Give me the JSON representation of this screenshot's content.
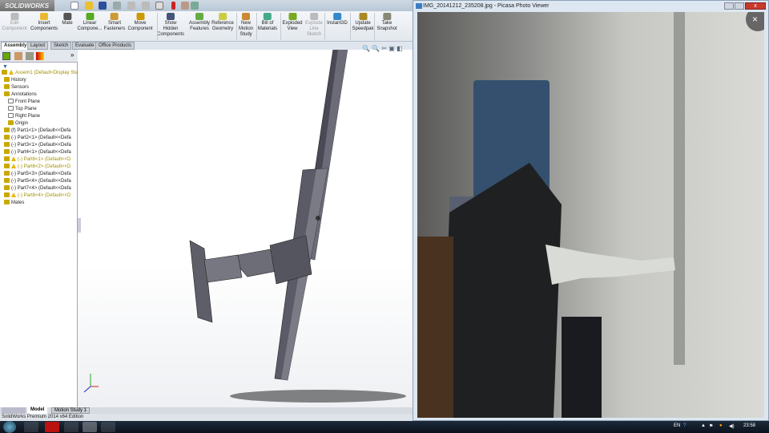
{
  "solidworks": {
    "logo": "SOLIDWORKS",
    "ribbon": [
      {
        "label": "Edit\nComponent",
        "disabled": true
      },
      {
        "label": "Insert\nComponents"
      },
      {
        "label": "Mate"
      },
      {
        "label": "Linear\nCompone..."
      },
      {
        "label": "Smart\nFasteners"
      },
      {
        "label": "Move\nComponent"
      },
      {
        "label": "Show\nHidden\nComponents"
      },
      {
        "label": "Assembly\nFeatures"
      },
      {
        "label": "Reference\nGeometry"
      },
      {
        "label": "New\nMotion\nStudy"
      },
      {
        "label": "Bill of\nMaterials"
      },
      {
        "label": "Exploded\nView"
      },
      {
        "label": "Explode\nLine\nSketch",
        "disabled": true
      },
      {
        "label": "Instant3D"
      },
      {
        "label": "Update\nSpeedpak"
      },
      {
        "label": "Take\nSnapshot"
      }
    ],
    "tabs": [
      "Assembly",
      "Layout",
      "Sketch",
      "Evaluate",
      "Office Products"
    ],
    "tree": [
      {
        "label": "Assem1  (Default<Display Sta",
        "warn": true,
        "y": true
      },
      {
        "label": "History"
      },
      {
        "label": "Sensors"
      },
      {
        "label": "Annotations"
      },
      {
        "label": "Front Plane"
      },
      {
        "label": "Top Plane"
      },
      {
        "label": "Right Plane"
      },
      {
        "label": "Origin"
      },
      {
        "label": "(f) Part1<1> (Default<<Defa"
      },
      {
        "label": "(-) Part2<1> (Default<<Defa"
      },
      {
        "label": "(-) Part3<1> (Default<<Defa"
      },
      {
        "label": "(-) Part4<1> (Default<<Defa"
      },
      {
        "label": "(-) Part6<1> (Default<<D",
        "warn": true,
        "y": true
      },
      {
        "label": "(-) Part6<2> (Default<<D",
        "warn": true,
        "y": true
      },
      {
        "label": "(-) Part5<3> (Default<<Defa"
      },
      {
        "label": "(-) Part5<4> (Default<<Defa"
      },
      {
        "label": "(-) Part7<4> (Default<<Defa"
      },
      {
        "label": "(-) Part8<4> (Default<<D",
        "warn": true,
        "y": true
      },
      {
        "label": "Mates"
      }
    ],
    "bottom_tabs": [
      "Model",
      "Motion Study 1"
    ],
    "status": "SolidWorks Premium 2014 x64 Edition"
  },
  "picasa": {
    "title": "IMG_20141212_235208.jpg - Picasa Photo Viewer",
    "close": "×"
  },
  "taskbar": {
    "lang": "EN",
    "clock": "23:58"
  }
}
